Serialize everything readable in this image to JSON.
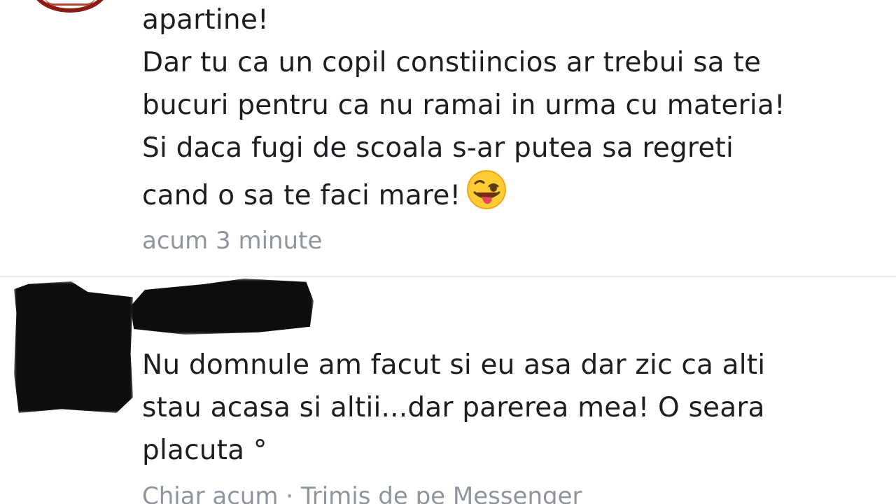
{
  "comments": [
    {
      "lines": [
        "apartine!",
        "Dar tu ca un copil constiincios ar trebui sa te",
        "bucuri pentru ca nu ramai in urma cu materia!",
        "Si daca fugi de scoala s-ar putea sa regreti",
        "cand o sa te faci mare!"
      ],
      "emoji": "winking-face-with-tongue",
      "timestamp": "acum 3 minute"
    },
    {
      "lines": [
        "Nu domnule am facut si eu asa dar zic ca alti",
        "stau acasa si altii...dar parerea mea! O seara",
        "placuta °"
      ],
      "timestamp": "Chiar acum · Trimis de pe Messenger"
    }
  ],
  "colors": {
    "text": "#1c1e21",
    "meta": "#90949c",
    "divider": "#e9ebee",
    "avatar_ring": "#8c1c13",
    "redaction": "#0d0d0d"
  }
}
